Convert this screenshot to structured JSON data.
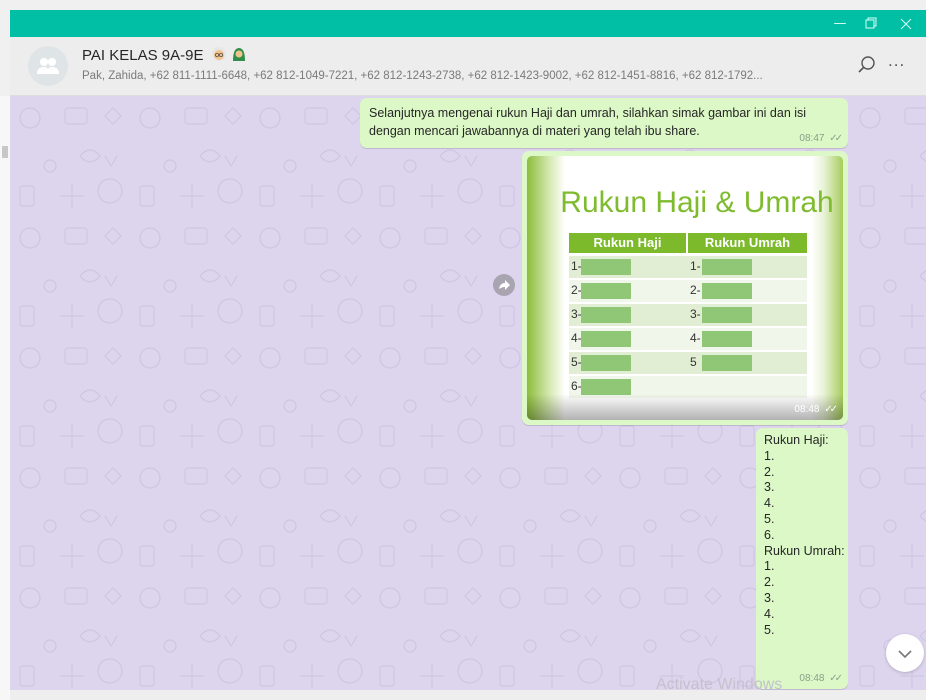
{
  "window": {
    "accent_color": "#00bfa5",
    "controls": [
      "minimize-icon",
      "restore-icon",
      "close-icon"
    ]
  },
  "header": {
    "group_name": "PAI KELAS 9A-9E",
    "group_emoji": [
      "old-woman-emoji",
      "woman-headscarf-emoji"
    ],
    "members": "Pak, Zahida, +62 811-1111-6648, +62 812-1049-7221, +62 812-1243-2738, +62 812-1423-9002, +62 812-1451-8816, +62 812-1792...",
    "icons": [
      "search-icon",
      "menu-dots-icon"
    ],
    "menu_dots": "..."
  },
  "messages": [
    {
      "type": "text",
      "text": "Selanjutnya mengenai rukun Haji dan umrah, silahkan simak gambar ini  dan isi dengan mencari jawabannya di materi yang telah ibu share.",
      "time": "08:47",
      "status": "double-check-icon"
    },
    {
      "type": "image",
      "time": "08:48",
      "status": "double-check-icon",
      "image": {
        "title": "Rukun Haji & Umrah",
        "col1": "Rukun Haji",
        "col2": "Rukun Umrah",
        "rows": [
          {
            "a": "1-",
            "b": "1-"
          },
          {
            "a": "2-",
            "b": "2-"
          },
          {
            "a": "3-",
            "b": "3-"
          },
          {
            "a": "4-",
            "b": "4-"
          },
          {
            "a": "5-",
            "b": "5"
          },
          {
            "a": "6-",
            "b": ""
          }
        ]
      }
    },
    {
      "type": "text",
      "lines": [
        "Rukun Haji:",
        "1.",
        "2.",
        "3.",
        "4.",
        "5.",
        "6.",
        "Rukun Umrah:",
        "1.",
        "2.",
        "3.",
        "4.",
        "5."
      ],
      "time": "08:48",
      "status": "double-check-icon"
    }
  ],
  "overlay": {
    "activate_windows": "Activate Windows"
  },
  "colors": {
    "chat_background": "#ddd5ee",
    "outgoing_bubble": "#dcf8c6",
    "table_header": "#7cba2c",
    "table_blank": "#8fc776"
  }
}
